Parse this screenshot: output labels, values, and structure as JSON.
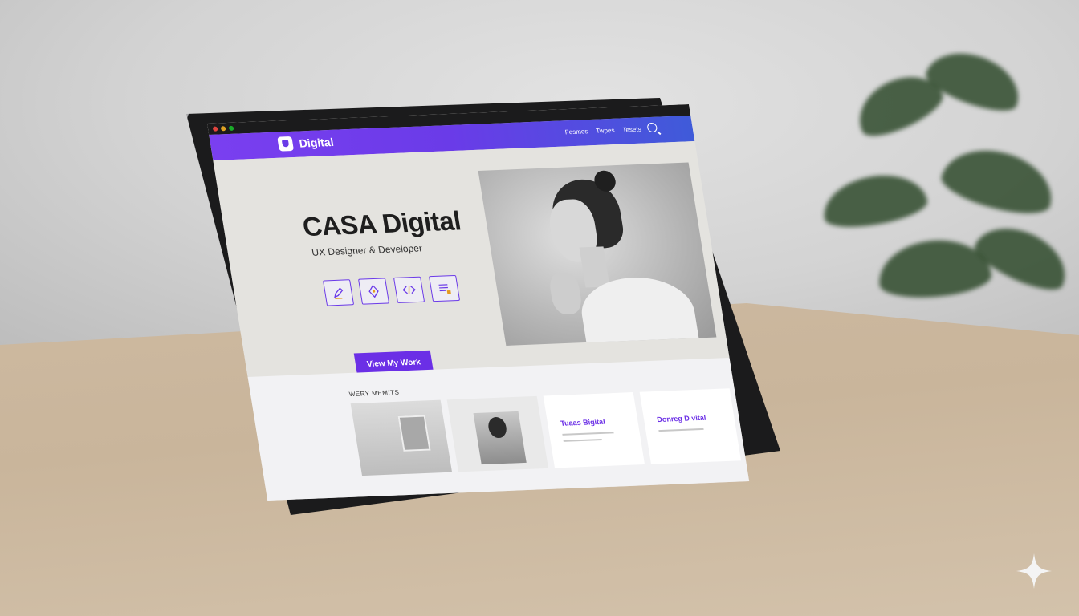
{
  "browser": {
    "dot_colors": [
      "#e0443e",
      "#dea123",
      "#1aab29"
    ]
  },
  "navbar": {
    "logo_text": "Digital",
    "links": [
      "Fesmes",
      "Twpes",
      "Tesets"
    ],
    "search_icon": "search-icon",
    "gradient": [
      "#7a3ff0",
      "#3f5bd9"
    ]
  },
  "hero": {
    "title": "CASA Digital",
    "subtitle": "UX Designer & Developer",
    "skills": [
      "pen-icon",
      "vector-icon",
      "code-icon",
      "document-icon"
    ],
    "cta_label": "View My Work",
    "accent": "#6b2fe6"
  },
  "section": {
    "title": "WERY MEMITS",
    "cards": [
      {
        "type": "image"
      },
      {
        "type": "image"
      },
      {
        "type": "text",
        "label": "Tuaas Bigital"
      },
      {
        "type": "text",
        "label": "Donreg D vital"
      }
    ]
  }
}
